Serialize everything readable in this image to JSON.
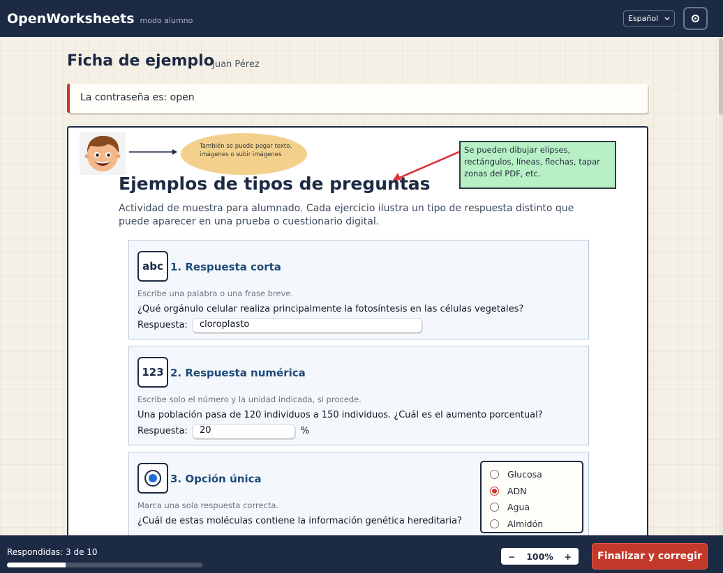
{
  "app": {
    "name": "OpenWorksheets",
    "mode": "modo alumno"
  },
  "language": {
    "selected": "Español"
  },
  "worksheet": {
    "title": "Ficha de ejemplo",
    "author": "Juan Pérez"
  },
  "password_notice": "La contraseña es: open",
  "annotations": {
    "bubble": "También se puede pegar texto, imágenes o subir imágenes",
    "note": "Se pueden dibujar elipses, rectángulos, líneas, flechas, tapar zonas del PDF, etc."
  },
  "content": {
    "heading": "Ejemplos de tipos de preguntas",
    "intro": "Actividad de muestra para alumnado. Cada ejercicio ilustra un tipo de respuesta distinto que puede aparecer en una prueba o cuestionario digital."
  },
  "questions": [
    {
      "icon": "abc",
      "title": "1. Respuesta corta",
      "hint": "Escribe una palabra o una frase breve.",
      "text": "¿Qué orgánulo celular realiza principalmente la fotosíntesis en las células vegetales?",
      "answer_label": "Respuesta:",
      "answer_value": "cloroplasto"
    },
    {
      "icon": "123",
      "title": "2. Respuesta numérica",
      "hint": "Escribe solo el número y la unidad indicada, si procede.",
      "text": "Una población pasa de 120 individuos a 150 individuos. ¿Cuál es el aumento porcentual?",
      "answer_label": "Respuesta:",
      "answer_value": "20",
      "unit": "%"
    },
    {
      "icon": "radio-icon",
      "title": "3. Opción única",
      "hint": "Marca una sola respuesta correcta.",
      "text": "¿Cuál de estas moléculas contiene la información genética hereditaria?",
      "options": [
        "Glucosa",
        "ADN",
        "Agua",
        "Almidón"
      ],
      "selected_index": 1
    }
  ],
  "footer": {
    "answered_text": "Respondidas: 3 de 10",
    "answered": 3,
    "total": 10,
    "zoom_minus": "−",
    "zoom_level": "100%",
    "zoom_plus": "+",
    "finish_label": "Finalizar y corregir"
  },
  "colors": {
    "navy": "#1d2a44",
    "accent_red": "#c43a2a",
    "note_green": "#b8f0c6",
    "bubble_yellow": "#f3d18d"
  }
}
